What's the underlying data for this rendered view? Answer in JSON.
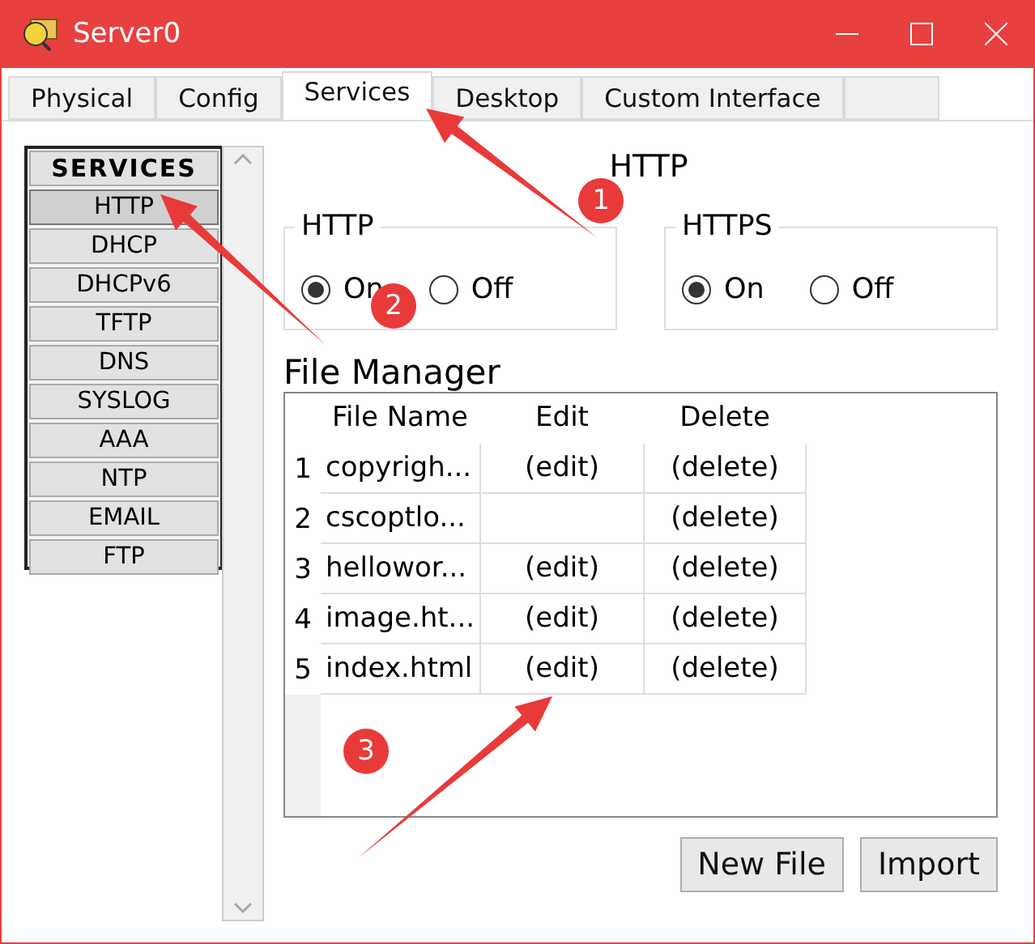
{
  "window": {
    "title": "Server0"
  },
  "tabs": [
    {
      "label": "Physical",
      "selected": false
    },
    {
      "label": "Config",
      "selected": false
    },
    {
      "label": "Services",
      "selected": true
    },
    {
      "label": "Desktop",
      "selected": false
    },
    {
      "label": "Custom Interface",
      "selected": false
    }
  ],
  "sidebar": {
    "header": "SERVICES",
    "items": [
      {
        "label": "HTTP",
        "selected": true
      },
      {
        "label": "DHCP",
        "selected": false
      },
      {
        "label": "DHCPv6",
        "selected": false
      },
      {
        "label": "TFTP",
        "selected": false
      },
      {
        "label": "DNS",
        "selected": false
      },
      {
        "label": "SYSLOG",
        "selected": false
      },
      {
        "label": "AAA",
        "selected": false
      },
      {
        "label": "NTP",
        "selected": false
      },
      {
        "label": "EMAIL",
        "selected": false
      },
      {
        "label": "FTP",
        "selected": false
      }
    ]
  },
  "heading": "HTTP",
  "groups": [
    {
      "title": "HTTP",
      "options": [
        {
          "label": "On",
          "selected": true
        },
        {
          "label": "Off",
          "selected": false
        }
      ]
    },
    {
      "title": "HTTPS",
      "options": [
        {
          "label": "On",
          "selected": true
        },
        {
          "label": "Off",
          "selected": false
        }
      ]
    }
  ],
  "file_manager": {
    "title": "File Manager",
    "columns": [
      "File Name",
      "Edit",
      "Delete"
    ],
    "rows": [
      {
        "index": "1",
        "name": "copyrigh...",
        "edit": "(edit)",
        "delete": "(delete)"
      },
      {
        "index": "2",
        "name": "cscoptlo...",
        "delete": "(delete)"
      },
      {
        "index": "3",
        "name": "hellowor...",
        "edit": "(edit)",
        "delete": "(delete)"
      },
      {
        "index": "4",
        "name": "image.ht...",
        "edit": "(edit)",
        "delete": "(delete)"
      },
      {
        "index": "5",
        "name": "index.html",
        "edit": "(edit)",
        "delete": "(delete)"
      }
    ]
  },
  "buttons": [
    "New File",
    "Import"
  ],
  "annotations": [
    {
      "number": "1"
    },
    {
      "number": "2"
    },
    {
      "number": "3"
    }
  ]
}
